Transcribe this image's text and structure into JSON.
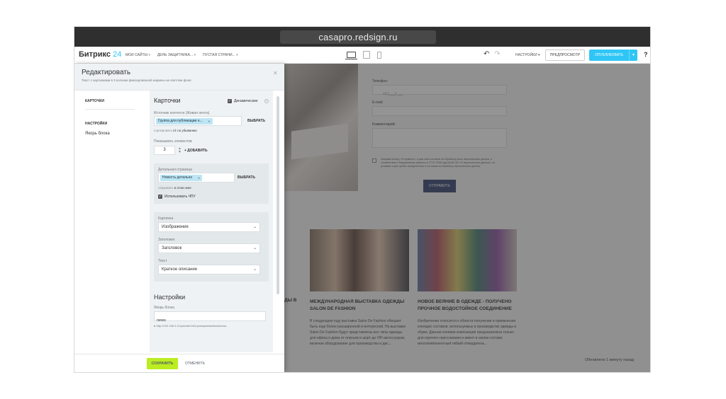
{
  "browser": {
    "url": "casapro.redsign.ru"
  },
  "topbar": {
    "logo_text": "Битрикс",
    "logo_num": "24",
    "breadcrumbs": [
      "МОИ САЙТЫ",
      "ДЕНЬ ЗАЩИТНИКА...",
      "ПУСТАЯ СТРАНИ..."
    ],
    "settings_label": "НАСТРОЙКИ",
    "preview_label": "ПРЕДПРОСМОТР",
    "publish_label": "ОПУБЛИКОВАТЬ",
    "help_label": "?"
  },
  "editor": {
    "title": "Редактировать",
    "subtitle": "Текст с картинками в 3 колонки фиксированной ширины на светлом фоне",
    "nav": {
      "cards": "КАРТОЧКИ",
      "settings": "НАСТРОЙКИ",
      "anchor": "Якорь блока"
    },
    "cards_section": {
      "title": "Карточки",
      "dynamic_label": "Динамические",
      "source_label": "Источник контента (Живая лента)",
      "source_value": "Группа для публикации н...",
      "choose_label": "ВЫБРАТЬ",
      "sort_hint_prefix": "сортировать",
      "sort_hint_value": "id: по убыванию",
      "show_label": "Показывать элементов",
      "show_value": "3",
      "add_label": "+ ДОБАВИТЬ",
      "detail_label": "Детальная страница",
      "detail_value": "Новость детально",
      "detail_choose": "ВЫБРАТЬ",
      "open_hint_prefix": "открывать",
      "open_hint_value": "в этом окне",
      "use_cpu_label": "Использовать ЧПУ",
      "picture_label": "Картинка",
      "picture_value": "Изображение",
      "heading_label": "Заголовок",
      "heading_value": "Заголовок",
      "text_label": "Текст",
      "text_value": "Краткое описание"
    },
    "settings_section": {
      "title": "Настройки",
      "anchor_label": "Якорь блока",
      "anchor_value": "news",
      "anchor_url": "http://192.168.3.11/pub/site/181/pustayastranitsa/#news"
    },
    "save_label": "СОХРАНИТЬ",
    "cancel_label": "ОТМЕНИТЬ"
  },
  "page": {
    "phone_label": "Телефон:",
    "phone_value": "+1 (___) ___",
    "email_label": "E-mail:",
    "comment_label": "Комментарий:",
    "consent_text": "Нажимая кнопку «Отправить», я даю свое согласие на обработку моих персональных данных, в соответствии с Федеральным законом от 27.07.2006 года №152-ФЗ «О персональных данных», на условиях и для целей, определенных в Согласии на обработку персональных данных",
    "send_label": "ОТПРАВИТЬ",
    "left_fragment_title": "ДЫ В",
    "news": [
      {
        "title": "МЕЖДУНАРОДНАЯ ВЫСТАВКА ОДЕЖДЫ SALON DE FASHION",
        "text": "В следующем году выставка Salon De Fashion обещает быть еще более расширенной и интересной. На выставке Salon De Fashion будут представлены все типы одежды для офиса и дома от платьев и шорт до VIP-аксессуаров, включая оборудование для производства и дис..."
      },
      {
        "title": "НОВОЕ ВЕЯНИЕ В ОДЕЖДЕ - ПОЛУЧЕНО ПРОЧНОЕ ВОДОСТОЙКОЕ СОЕДИНЕНИЕ",
        "text": "Изобретение относится к области получения и применения клеящих составов, используемых в производстве одежды и обуви. Данная клеевая композиция предназначена только для горячего прессования и имеет в своем составе многокомпонентный гибкий отвердитель..."
      }
    ],
    "status_text": "Обновлено 1 минуту назад"
  }
}
